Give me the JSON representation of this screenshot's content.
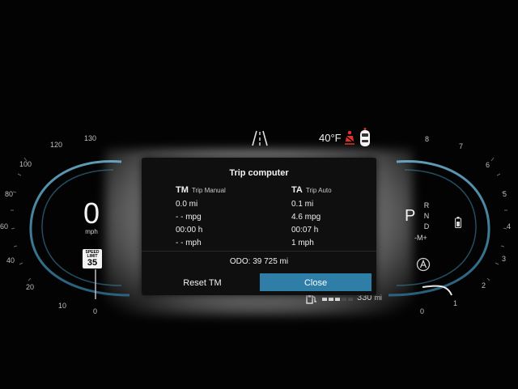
{
  "topbar": {
    "road_icon": "lane-road-icon",
    "temperature": "40°F",
    "warning_icon": "seatbelt-warning-icon",
    "car_icon": "car-top-view-icon",
    "warning_color": "#e0342b"
  },
  "speedometer": {
    "value": "0",
    "unit": "mph",
    "ticks": [
      "130",
      "120",
      "100",
      "80",
      "60",
      "40",
      "20",
      "10",
      "0"
    ],
    "speed_limit": {
      "label": "SPEED LIMIT",
      "value": "35"
    }
  },
  "tachometer": {
    "ticks": [
      "8",
      "7",
      "6",
      "5",
      "4",
      "3",
      "2",
      "1",
      "0"
    ],
    "gear_selected": "P",
    "gears": [
      "R",
      "N",
      "D"
    ],
    "manual": "-M+",
    "auto_icon": "auto-start-stop-icon",
    "battery_icon": "battery-icon"
  },
  "range": {
    "icon": "fuel-pump-icon",
    "value": "330",
    "unit": "mi",
    "fuel_level": 0.5
  },
  "trip_computer": {
    "title": "Trip computer",
    "tm": {
      "abbr": "TM",
      "name": "Trip Manual",
      "distance": "0.0 mi",
      "consumption": "- - mpg",
      "time": "00:00 h",
      "speed": "- - mph"
    },
    "ta": {
      "abbr": "TA",
      "name": "Trip Auto",
      "distance": "0.1 mi",
      "consumption": "4.6 mpg",
      "time": "00:07 h",
      "speed": "1 mph"
    },
    "odo": "ODO:  39 725 mi",
    "reset_label": "Reset TM",
    "close_label": "Close",
    "accent": "#2f7ea8"
  }
}
